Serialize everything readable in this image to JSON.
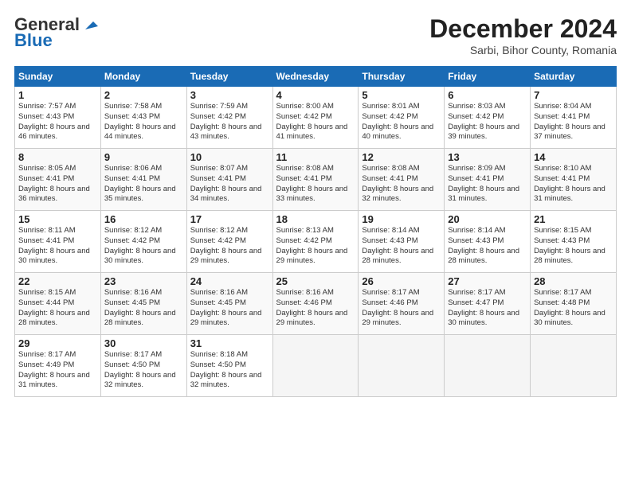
{
  "header": {
    "logo_line1": "General",
    "logo_line2": "Blue",
    "month": "December 2024",
    "location": "Sarbi, Bihor County, Romania"
  },
  "days_of_week": [
    "Sunday",
    "Monday",
    "Tuesday",
    "Wednesday",
    "Thursday",
    "Friday",
    "Saturday"
  ],
  "weeks": [
    [
      {
        "day": 1,
        "sunrise": "7:57 AM",
        "sunset": "4:43 PM",
        "daylight": "8 hours and 46 minutes."
      },
      {
        "day": 2,
        "sunrise": "7:58 AM",
        "sunset": "4:43 PM",
        "daylight": "8 hours and 44 minutes."
      },
      {
        "day": 3,
        "sunrise": "7:59 AM",
        "sunset": "4:42 PM",
        "daylight": "8 hours and 43 minutes."
      },
      {
        "day": 4,
        "sunrise": "8:00 AM",
        "sunset": "4:42 PM",
        "daylight": "8 hours and 41 minutes."
      },
      {
        "day": 5,
        "sunrise": "8:01 AM",
        "sunset": "4:42 PM",
        "daylight": "8 hours and 40 minutes."
      },
      {
        "day": 6,
        "sunrise": "8:03 AM",
        "sunset": "4:42 PM",
        "daylight": "8 hours and 39 minutes."
      },
      {
        "day": 7,
        "sunrise": "8:04 AM",
        "sunset": "4:41 PM",
        "daylight": "8 hours and 37 minutes."
      }
    ],
    [
      {
        "day": 8,
        "sunrise": "8:05 AM",
        "sunset": "4:41 PM",
        "daylight": "8 hours and 36 minutes."
      },
      {
        "day": 9,
        "sunrise": "8:06 AM",
        "sunset": "4:41 PM",
        "daylight": "8 hours and 35 minutes."
      },
      {
        "day": 10,
        "sunrise": "8:07 AM",
        "sunset": "4:41 PM",
        "daylight": "8 hours and 34 minutes."
      },
      {
        "day": 11,
        "sunrise": "8:08 AM",
        "sunset": "4:41 PM",
        "daylight": "8 hours and 33 minutes."
      },
      {
        "day": 12,
        "sunrise": "8:08 AM",
        "sunset": "4:41 PM",
        "daylight": "8 hours and 32 minutes."
      },
      {
        "day": 13,
        "sunrise": "8:09 AM",
        "sunset": "4:41 PM",
        "daylight": "8 hours and 31 minutes."
      },
      {
        "day": 14,
        "sunrise": "8:10 AM",
        "sunset": "4:41 PM",
        "daylight": "8 hours and 31 minutes."
      }
    ],
    [
      {
        "day": 15,
        "sunrise": "8:11 AM",
        "sunset": "4:41 PM",
        "daylight": "8 hours and 30 minutes."
      },
      {
        "day": 16,
        "sunrise": "8:12 AM",
        "sunset": "4:42 PM",
        "daylight": "8 hours and 30 minutes."
      },
      {
        "day": 17,
        "sunrise": "8:12 AM",
        "sunset": "4:42 PM",
        "daylight": "8 hours and 29 minutes."
      },
      {
        "day": 18,
        "sunrise": "8:13 AM",
        "sunset": "4:42 PM",
        "daylight": "8 hours and 29 minutes."
      },
      {
        "day": 19,
        "sunrise": "8:14 AM",
        "sunset": "4:43 PM",
        "daylight": "8 hours and 28 minutes."
      },
      {
        "day": 20,
        "sunrise": "8:14 AM",
        "sunset": "4:43 PM",
        "daylight": "8 hours and 28 minutes."
      },
      {
        "day": 21,
        "sunrise": "8:15 AM",
        "sunset": "4:43 PM",
        "daylight": "8 hours and 28 minutes."
      }
    ],
    [
      {
        "day": 22,
        "sunrise": "8:15 AM",
        "sunset": "4:44 PM",
        "daylight": "8 hours and 28 minutes."
      },
      {
        "day": 23,
        "sunrise": "8:16 AM",
        "sunset": "4:45 PM",
        "daylight": "8 hours and 28 minutes."
      },
      {
        "day": 24,
        "sunrise": "8:16 AM",
        "sunset": "4:45 PM",
        "daylight": "8 hours and 29 minutes."
      },
      {
        "day": 25,
        "sunrise": "8:16 AM",
        "sunset": "4:46 PM",
        "daylight": "8 hours and 29 minutes."
      },
      {
        "day": 26,
        "sunrise": "8:17 AM",
        "sunset": "4:46 PM",
        "daylight": "8 hours and 29 minutes."
      },
      {
        "day": 27,
        "sunrise": "8:17 AM",
        "sunset": "4:47 PM",
        "daylight": "8 hours and 30 minutes."
      },
      {
        "day": 28,
        "sunrise": "8:17 AM",
        "sunset": "4:48 PM",
        "daylight": "8 hours and 30 minutes."
      }
    ],
    [
      {
        "day": 29,
        "sunrise": "8:17 AM",
        "sunset": "4:49 PM",
        "daylight": "8 hours and 31 minutes."
      },
      {
        "day": 30,
        "sunrise": "8:17 AM",
        "sunset": "4:50 PM",
        "daylight": "8 hours and 32 minutes."
      },
      {
        "day": 31,
        "sunrise": "8:18 AM",
        "sunset": "4:50 PM",
        "daylight": "8 hours and 32 minutes."
      },
      null,
      null,
      null,
      null
    ]
  ]
}
